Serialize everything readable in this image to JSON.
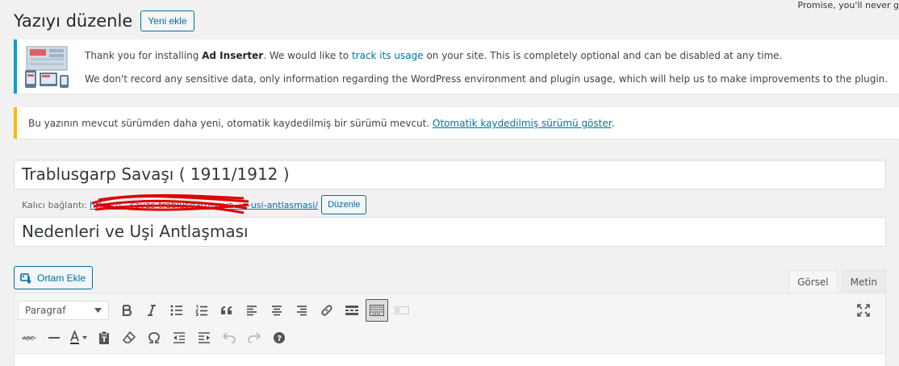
{
  "top_right": {
    "text": "Promise, you'll never g"
  },
  "header": {
    "title": "Yazıyı düzenle",
    "add_new_label": "Yeni ekle"
  },
  "notice_info": {
    "line1_prefix": "Thank you for installing ",
    "line1_bold": "Ad Inserter",
    "line1_mid": ". We would like to ",
    "line1_link": "track its usage",
    "line1_suffix": " on your site. This is completely optional and can be disabled at any time.",
    "line2": "We don't record any sensitive data, only information regarding the WordPress environment and plugin usage, which will help us to make improvements to the plugin."
  },
  "notice_autosave": {
    "text": "Bu yazının mevcut sürümden daha yeni, otomatik kaydedilmiş bir sürümü mevcut. ",
    "link": "Otomatik kaydedilmiş sürümü göster",
    "suffix": "."
  },
  "post": {
    "title": "Trablusgarp Savaşı ( 1911/1912 )",
    "permalink_label": "Kalıcı bağlantı:",
    "permalink_url": "https://...savas-trablusgarp-sava...e-usi-antlasmasi/",
    "edit_slug_label": "Düzenle",
    "subtitle": "Nedenleri ve Uşi Antlaşması"
  },
  "editor": {
    "add_media_label": "Ortam Ekle",
    "tabs": [
      {
        "label": "Görsel",
        "active": true
      },
      {
        "label": "Metin",
        "active": false
      }
    ],
    "format_select": "Paragraf"
  },
  "colors": {
    "accent": "#0071a1",
    "info_border": "#00a0d2",
    "warning_border": "#ffb900",
    "link": "#0073aa"
  },
  "icons": {
    "row1": [
      "bold-icon",
      "italic-icon",
      "bulleted-list-icon",
      "numbered-list-icon",
      "blockquote-icon",
      "align-left-icon",
      "align-center-icon",
      "align-right-icon",
      "insert-link-icon",
      "read-more-icon",
      "toolbar-toggle-icon",
      "ad-inserter-icon"
    ],
    "row2": [
      "strikethrough-icon",
      "horizontal-line-icon",
      "text-color-icon",
      "paste-as-text-icon",
      "clear-formatting-icon",
      "special-character-icon",
      "outdent-icon",
      "indent-icon",
      "undo-icon",
      "redo-icon",
      "keyboard-shortcuts-icon"
    ],
    "fullscreen": "fullscreen-icon"
  }
}
